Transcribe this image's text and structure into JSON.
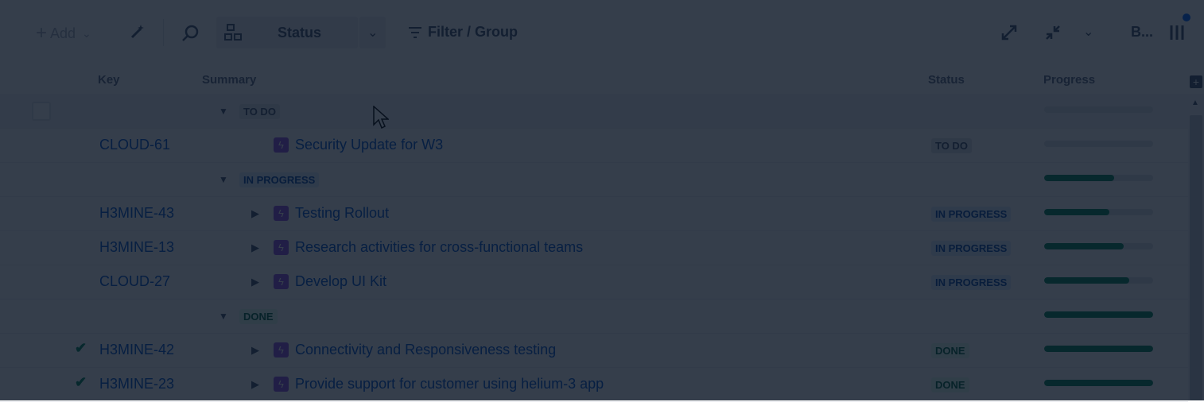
{
  "toolbar": {
    "add_label": "Add",
    "status_label": "Status",
    "filter_label": "Filter / Group",
    "user_initial": "B..."
  },
  "columns": {
    "key": "Key",
    "summary": "Summary",
    "status": "Status",
    "progress": "Progress"
  },
  "groups": [
    {
      "label": "TO DO",
      "progress": 0.0
    },
    {
      "label": "IN PROGRESS",
      "progress": 0.64
    },
    {
      "label": "DONE",
      "progress": 1.0
    }
  ],
  "rows": [
    {
      "key": "CLOUD-61",
      "summary": "Security Update for W3",
      "status": "TO DO",
      "progress": 0.0,
      "done": false
    },
    {
      "key": "H3MINE-43",
      "summary": "Testing Rollout",
      "status": "IN PROGRESS",
      "progress": 0.6,
      "done": false
    },
    {
      "key": "H3MINE-13",
      "summary": "Research activities for cross-functional teams",
      "status": "IN PROGRESS",
      "progress": 0.73,
      "done": false
    },
    {
      "key": "CLOUD-27",
      "summary": "Develop UI Kit",
      "status": "IN PROGRESS",
      "progress": 0.78,
      "done": false
    },
    {
      "key": "H3MINE-42",
      "summary": "Connectivity and Responsiveness testing",
      "status": "DONE",
      "progress": 1.0,
      "done": true
    },
    {
      "key": "H3MINE-23",
      "summary": "Provide support for customer using helium-3 app",
      "status": "DONE",
      "progress": 1.0,
      "done": true
    }
  ],
  "colors": {
    "accent": "#0052cc",
    "done": "#00875a",
    "epic": "#904ee2"
  }
}
